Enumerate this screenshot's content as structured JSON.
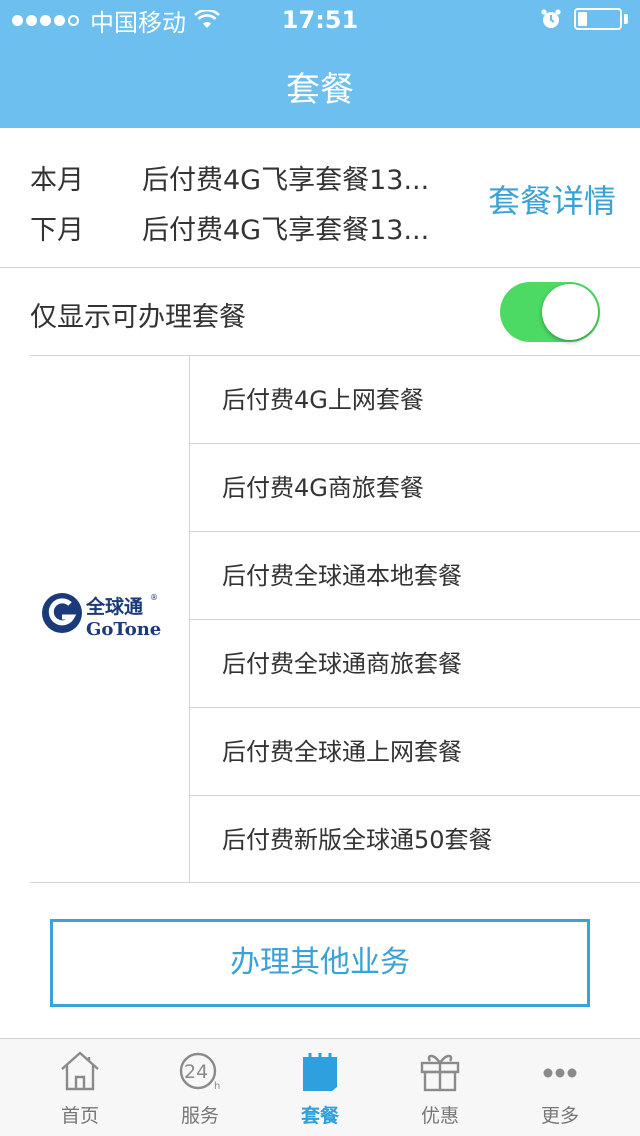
{
  "status_bar": {
    "carrier": "中国移动",
    "time": "17:51"
  },
  "header": {
    "title": "套餐"
  },
  "current_plan": {
    "this_month_label": "本月",
    "this_month_value": "后付费4G飞享套餐13...",
    "next_month_label": "下月",
    "next_month_value": "后付费4G飞享套餐13...",
    "detail_link": "套餐详情"
  },
  "filter": {
    "label": "仅显示可办理套餐",
    "enabled": true
  },
  "brand": {
    "logo_text_cn": "全球通",
    "logo_text_en": "GoTone"
  },
  "packages": [
    "后付费4G上网套餐",
    "后付费4G商旅套餐",
    "后付费全球通本地套餐",
    "后付费全球通商旅套餐",
    "后付费全球通上网套餐",
    "后付费新版全球通50套餐"
  ],
  "other_button": "办理其他业务",
  "tabbar": {
    "items": [
      {
        "label": "首页",
        "icon": "home-icon",
        "active": false
      },
      {
        "label": "服务",
        "icon": "24h-service-icon",
        "active": false
      },
      {
        "label": "套餐",
        "icon": "package-icon",
        "active": true
      },
      {
        "label": "优惠",
        "icon": "gift-icon",
        "active": false
      },
      {
        "label": "更多",
        "icon": "more-icon",
        "active": false
      }
    ]
  },
  "colors": {
    "header_bg": "#6cbfee",
    "accent": "#3aa2d6",
    "toggle_on": "#4cd964",
    "tab_active": "#2ea0de"
  }
}
